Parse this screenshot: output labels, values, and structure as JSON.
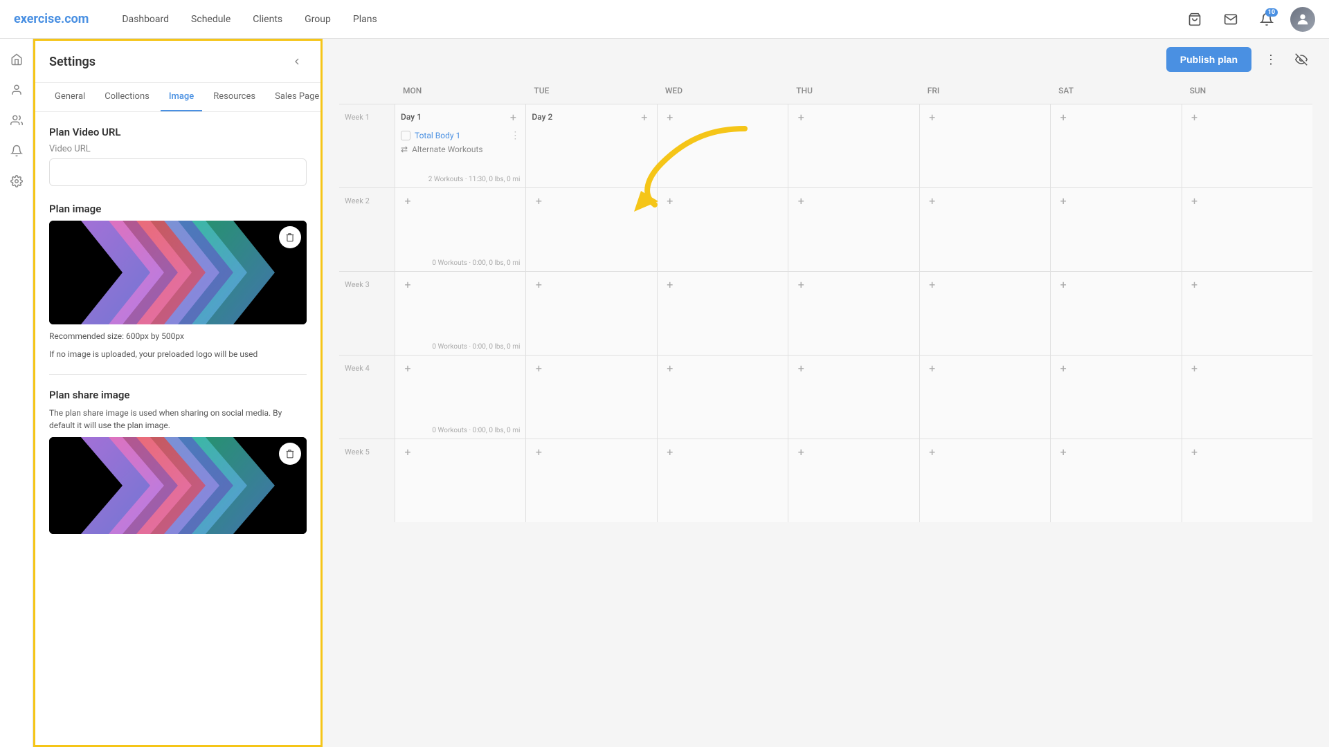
{
  "app": {
    "logo_text": "exercise",
    "logo_domain": ".com"
  },
  "nav": {
    "links": [
      "Dashboard",
      "Schedule",
      "Clients",
      "Group",
      "Plans"
    ],
    "badge_count": "10"
  },
  "toolbar": {
    "publish_plan_label": "Publish plan"
  },
  "settings": {
    "title": "Settings",
    "tabs": [
      {
        "label": "General",
        "active": false
      },
      {
        "label": "Collections",
        "active": false
      },
      {
        "label": "Image",
        "active": true
      },
      {
        "label": "Resources",
        "active": false
      },
      {
        "label": "Sales Page",
        "active": false
      }
    ],
    "plan_video_url_section": "Plan Video URL",
    "video_url_label": "Video URL",
    "video_url_placeholder": "",
    "plan_image_section": "Plan image",
    "image_recommended_size": "Recommended size: 600px by 500px",
    "image_hint": "If no image is uploaded, your preloaded logo will be used",
    "plan_share_image_section": "Plan share image",
    "plan_share_image_desc": "The plan share image is used when sharing on social media. By default it will use the plan image."
  },
  "calendar": {
    "headers": [
      "",
      "MON",
      "TUE",
      "WED",
      "THU",
      "FRI",
      "SAT",
      "SUN"
    ],
    "weeks": [
      {
        "label": "Week 1",
        "days": [
          {
            "name": "Day 1",
            "workouts": [
              {
                "name": "Total Body 1",
                "has_alternate": true,
                "alternate_name": "Alternate Workouts"
              }
            ],
            "summary": "2 Workouts · 11:30, 0 lbs, 0 mi"
          },
          {
            "name": "Day 2",
            "workouts": [],
            "summary": ""
          },
          {
            "name": "",
            "workouts": [],
            "summary": ""
          },
          {
            "name": "",
            "workouts": [],
            "summary": ""
          },
          {
            "name": "",
            "workouts": [],
            "summary": ""
          },
          {
            "name": "",
            "workouts": [],
            "summary": ""
          },
          {
            "name": "",
            "workouts": [],
            "summary": ""
          }
        ]
      },
      {
        "label": "Week 2",
        "days": [
          {
            "name": "",
            "workouts": [],
            "summary": "0 Workouts · 0:00, 0 lbs, 0 mi"
          },
          {
            "name": "",
            "workouts": [],
            "summary": ""
          },
          {
            "name": "",
            "workouts": [],
            "summary": ""
          },
          {
            "name": "",
            "workouts": [],
            "summary": ""
          },
          {
            "name": "",
            "workouts": [],
            "summary": ""
          },
          {
            "name": "",
            "workouts": [],
            "summary": ""
          },
          {
            "name": "",
            "workouts": [],
            "summary": ""
          }
        ]
      },
      {
        "label": "Week 3",
        "days": [
          {
            "name": "",
            "workouts": [],
            "summary": "0 Workouts · 0:00, 0 lbs, 0 mi"
          },
          {
            "name": "",
            "workouts": [],
            "summary": ""
          },
          {
            "name": "",
            "workouts": [],
            "summary": ""
          },
          {
            "name": "",
            "workouts": [],
            "summary": ""
          },
          {
            "name": "",
            "workouts": [],
            "summary": ""
          },
          {
            "name": "",
            "workouts": [],
            "summary": ""
          },
          {
            "name": "",
            "workouts": [],
            "summary": ""
          }
        ]
      },
      {
        "label": "Week 4",
        "days": [
          {
            "name": "",
            "workouts": [],
            "summary": "0 Workouts · 0:00, 0 lbs, 0 mi"
          },
          {
            "name": "",
            "workouts": [],
            "summary": ""
          },
          {
            "name": "",
            "workouts": [],
            "summary": ""
          },
          {
            "name": "",
            "workouts": [],
            "summary": ""
          },
          {
            "name": "",
            "workouts": [],
            "summary": ""
          },
          {
            "name": "",
            "workouts": [],
            "summary": ""
          },
          {
            "name": "",
            "workouts": [],
            "summary": ""
          }
        ]
      },
      {
        "label": "Week 5",
        "days": [
          {
            "name": "",
            "workouts": [],
            "summary": ""
          },
          {
            "name": "",
            "workouts": [],
            "summary": ""
          },
          {
            "name": "",
            "workouts": [],
            "summary": ""
          },
          {
            "name": "",
            "workouts": [],
            "summary": ""
          },
          {
            "name": "",
            "workouts": [],
            "summary": ""
          },
          {
            "name": "",
            "workouts": [],
            "summary": ""
          },
          {
            "name": "",
            "workouts": [],
            "summary": ""
          }
        ]
      }
    ]
  },
  "colors": {
    "accent": "#4a90e2",
    "border": "#e0e0e0",
    "text_primary": "#333",
    "text_secondary": "#888",
    "arrow_color": "#f5c518"
  }
}
